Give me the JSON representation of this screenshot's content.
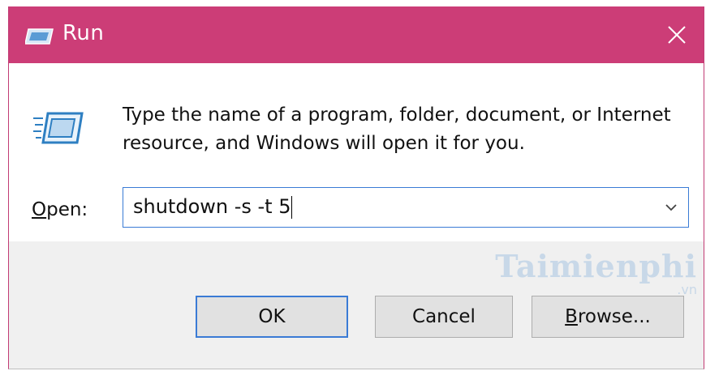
{
  "window": {
    "title": "Run",
    "title_icon": "run-icon",
    "close_icon": "close-icon",
    "accent_color": "#cc3d77"
  },
  "content": {
    "icon": "run-program-icon",
    "description": "Type the name of a program, folder, document, or Internet resource, and Windows will open it for you.",
    "open_label_accel": "O",
    "open_label_rest": "pen:",
    "input_value": "shutdown -s -t 5",
    "dropdown_icon": "chevron-down-icon"
  },
  "buttons": {
    "ok": "OK",
    "cancel": "Cancel",
    "browse_accel": "B",
    "browse_rest": "rowse..."
  },
  "watermark": {
    "main": "Taimienphi",
    "sub": ".vn"
  }
}
